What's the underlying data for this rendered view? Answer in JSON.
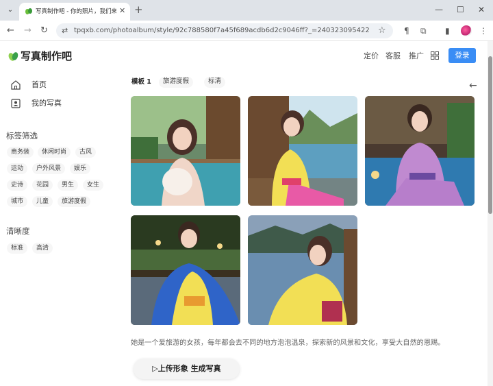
{
  "browser": {
    "tab_title": "写真制作吧 - 你的照片，我们来",
    "url": "tpqxb.com/photoalbum/style/92c788580f7a45f689acdb6d2c9046ff?_=240323095422",
    "tab_close": "✕",
    "new_tab": "+",
    "window_controls": [
      "—",
      "☐",
      "✕"
    ]
  },
  "header": {
    "logo_text": "写真制作吧",
    "nav": [
      "定价",
      "客服",
      "推广"
    ],
    "login_label": "登录",
    "accent_color": "#3a8df5"
  },
  "sidebar": {
    "items": [
      {
        "label": "首页",
        "icon": "home-icon"
      },
      {
        "label": "我的写真",
        "icon": "portrait-icon"
      }
    ],
    "tag_section_title": "标签筛选",
    "tags": [
      "商务装",
      "休闲时尚",
      "古风",
      "运动",
      "户外风景",
      "娱乐",
      "史诗",
      "花园",
      "男生",
      "女生",
      "城市",
      "儿童",
      "旅游度假"
    ],
    "quality_section_title": "清晰度",
    "quality_tags": [
      "标准",
      "高清"
    ]
  },
  "main": {
    "template_tabs": [
      "模板 1",
      "旅游度假",
      "标清"
    ],
    "photos": [
      {
        "name": "hot-spring-photo-1"
      },
      {
        "name": "lake-photo-2"
      },
      {
        "name": "pool-photo-3"
      },
      {
        "name": "garden-photo-4"
      },
      {
        "name": "lake-photo-5"
      }
    ],
    "description": "她是一个爱旅游的女孩，每年都会去不同的地方泡泡温泉，探索新的风景和文化，享受大自然的恩赐。",
    "generate_button": "▷上传形象 生成写真"
  }
}
